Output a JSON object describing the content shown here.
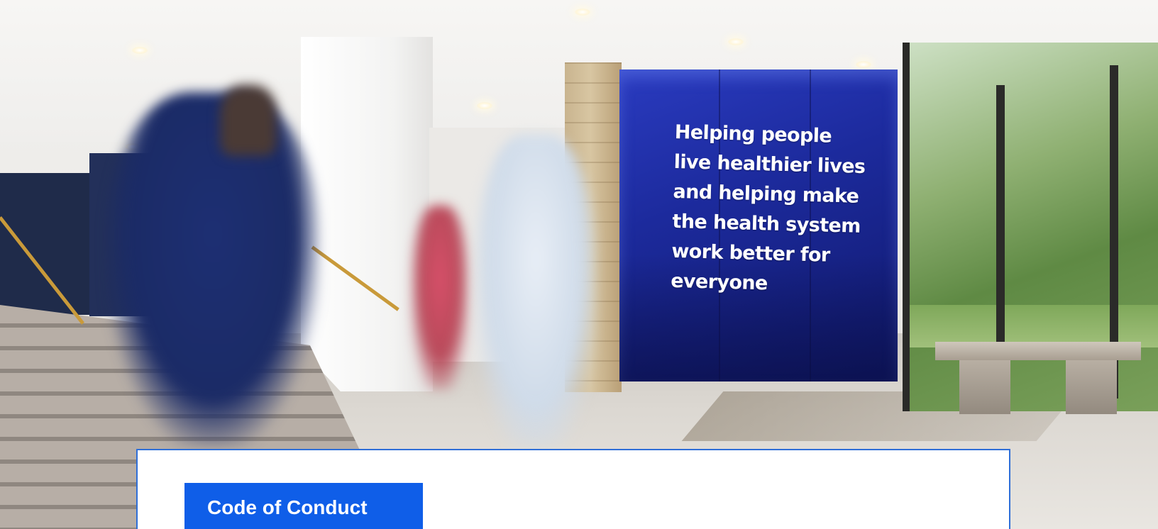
{
  "hero": {
    "image_alt": "Lobby with a blue wall reading the company mission and people walking",
    "wall_message": [
      "Helping people",
      "live healthier lives",
      "and helping make",
      "the health system",
      "work better for",
      "everyone"
    ]
  },
  "card": {
    "button_label": "Code of Conduct"
  },
  "colors": {
    "accent_blue": "#0f5ee8",
    "card_border": "#2f6fd8",
    "wall_blue": "#1c2a9c",
    "background": "#ffffff"
  }
}
